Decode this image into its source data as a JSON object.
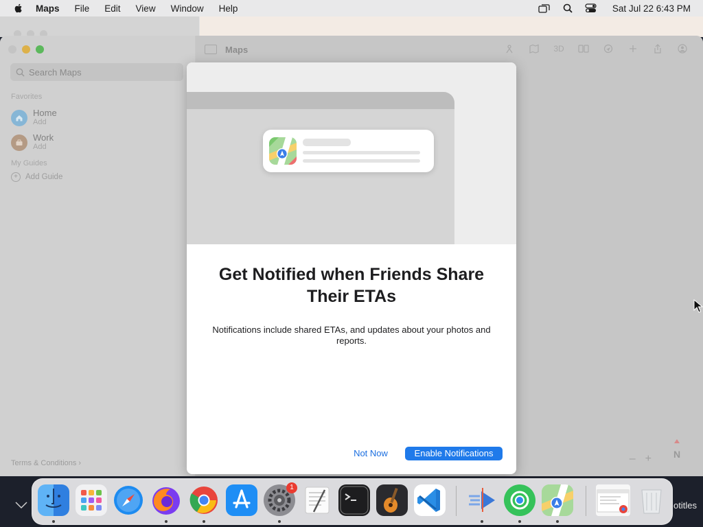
{
  "menubar": {
    "app": "Maps",
    "items": [
      "File",
      "Edit",
      "View",
      "Window",
      "Help"
    ],
    "clock": "Sat Jul 22  6:43 PM",
    "icons": [
      "apple-icon",
      "screen-mirroring-icon",
      "spotlight-search-icon",
      "control-center-icon"
    ]
  },
  "maps": {
    "title": "Maps",
    "search_placeholder": "Search Maps",
    "favorites_label": "Favorites",
    "favorites": [
      {
        "name": "Home",
        "sub": "Add",
        "color": "#86b6d6"
      },
      {
        "name": "Work",
        "sub": "Add",
        "color": "#b49a84"
      }
    ],
    "guides_label": "My Guides",
    "add_guide": "Add Guide",
    "terms": "Terms & Conditions ›",
    "zoom_out": "–",
    "zoom_in": "+",
    "compass": "N",
    "toolbar_icons": [
      "look-around-icon",
      "map-mode-icon",
      "3d-icon",
      "tracking-icon",
      "location-icon",
      "add-icon",
      "share-icon",
      "account-icon"
    ],
    "toolbar_3d": "3D"
  },
  "dialog": {
    "title": "Get Notified when Friends Share Their ETAs",
    "body": "Notifications include shared ETAs, and updates about your photos and reports.",
    "secondary_button": "Not Now",
    "primary_button": "Enable Notifications"
  },
  "dock": {
    "apps": [
      "Finder",
      "Launchpad",
      "Safari",
      "Firefox",
      "Chrome",
      "App Store",
      "System Settings",
      "TextEdit",
      "Terminal",
      "GarageBand",
      "Visual Studio Code",
      "Instruments",
      "Find My",
      "Maps",
      "Chrome Window",
      "Trash"
    ],
    "settings_badge": "1"
  },
  "background": {
    "subtitles_text": "otitles"
  },
  "colors": {
    "accent": "#1f7aea",
    "link": "#1c6fe0"
  }
}
